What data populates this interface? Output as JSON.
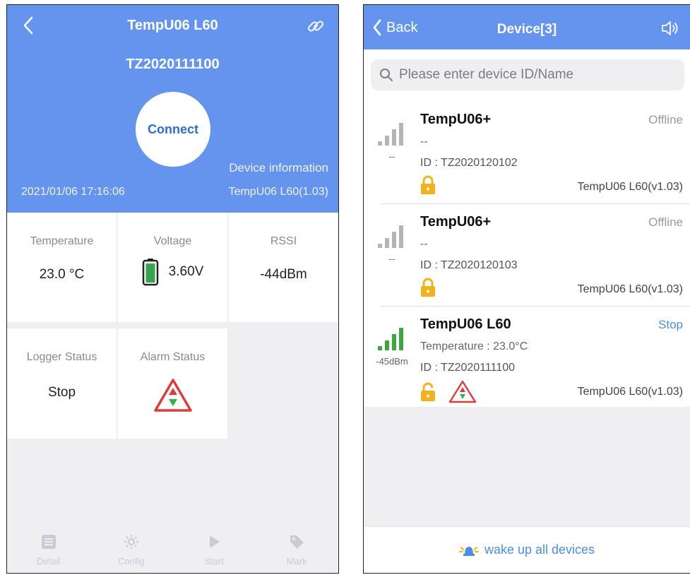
{
  "left": {
    "title": "TempU06 L60",
    "serial": "TZ2020111100",
    "connect_label": "Connect",
    "device_info_label": "Device information",
    "datetime": "2021/01/06 17:16:06",
    "model_version": "TempU06 L60(1.03)",
    "metrics": {
      "temperature": {
        "label": "Temperature",
        "value": "23.0 °C"
      },
      "voltage": {
        "label": "Voltage",
        "value": "3.60V"
      },
      "rssi": {
        "label": "RSSI",
        "value": "-44dBm"
      },
      "logger_status": {
        "label": "Logger Status",
        "value": "Stop"
      },
      "alarm_status": {
        "label": "Alarm Status",
        "icon": "alarm-triangle-icon"
      }
    },
    "tabs": [
      {
        "label": "Detail",
        "icon": "detail-icon"
      },
      {
        "label": "Config",
        "icon": "gear-icon"
      },
      {
        "label": "Start",
        "icon": "play-icon"
      },
      {
        "label": "Mark",
        "icon": "tag-icon"
      }
    ],
    "colors": {
      "header": "#6494ee",
      "battery": "#37a64a",
      "alarm_red": "#e03b3b",
      "alarm_green": "#2fb34a"
    }
  },
  "right": {
    "back_label": "Back",
    "title": "Device[3]",
    "search_placeholder": "Please enter device ID/Name",
    "devices": [
      {
        "name": "TempU06+",
        "status": "Offline",
        "line2": "--",
        "id": "ID : TZ2020120102",
        "rssi": "--",
        "version": "TempU06 L60(v1.03)",
        "lock": "locked",
        "signal": "grey"
      },
      {
        "name": "TempU06+",
        "status": "Offline",
        "line2": "--",
        "id": "ID : TZ2020120103",
        "rssi": "--",
        "version": "TempU06 L60(v1.03)",
        "lock": "locked",
        "signal": "grey"
      },
      {
        "name": "TempU06 L60",
        "status": "Stop",
        "line2": "Temperature : 23.0°C",
        "id": "ID : TZ2020111100",
        "rssi": "-45dBm",
        "version": "TempU06 L60(v1.03)",
        "lock": "unlocked",
        "signal": "green"
      }
    ],
    "wake_label": "wake up all devices",
    "colors": {
      "lock": "#f3b21b",
      "active_status": "#4a8fe3",
      "signal_green": "#3aa83f",
      "signal_grey": "#b5b5b5"
    }
  }
}
